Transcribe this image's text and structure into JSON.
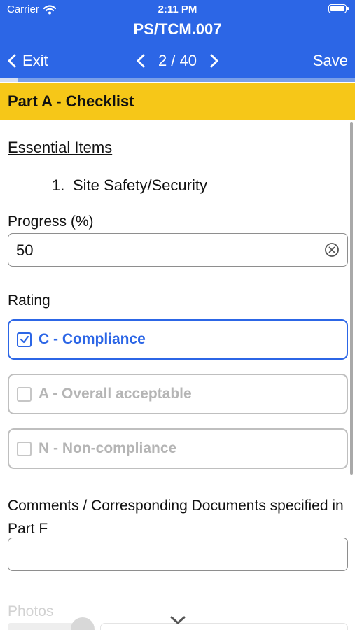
{
  "status_bar": {
    "carrier": "Carrier",
    "time": "2:11 PM"
  },
  "header": {
    "title": "PS/TCM.007",
    "exit_label": "Exit",
    "page_indicator": "2 / 40",
    "save_label": "Save",
    "page_progress": 0.05
  },
  "section": {
    "title": "Part A - Checklist"
  },
  "subheading": "Essential Items",
  "item": {
    "number": "1.",
    "text": "Site Safety/Security"
  },
  "progress_field": {
    "label": "Progress (%)",
    "value": "50"
  },
  "rating": {
    "label": "Rating",
    "options": [
      {
        "label": "C - Compliance",
        "checked": true
      },
      {
        "label": "A - Overall acceptable",
        "checked": false
      },
      {
        "label": "N - Non-compliance",
        "checked": false
      }
    ]
  },
  "comments": {
    "label": "Comments / Corresponding Documents specified in Part F",
    "value": ""
  },
  "photos": {
    "label": "Photos"
  },
  "colors": {
    "header_blue": "#2c66e6",
    "section_yellow": "#f6c718",
    "selected_blue": "#2c66e6",
    "disabled_gray": "#b5b5b5"
  },
  "icons": {
    "wifi": "wifi-icon",
    "battery": "battery-icon",
    "back": "chevron-left-icon",
    "prev": "chevron-left-icon",
    "next": "chevron-right-icon",
    "clear": "clear-circle-icon",
    "check": "checkmark-icon",
    "scroll": "chevron-down-icon"
  }
}
